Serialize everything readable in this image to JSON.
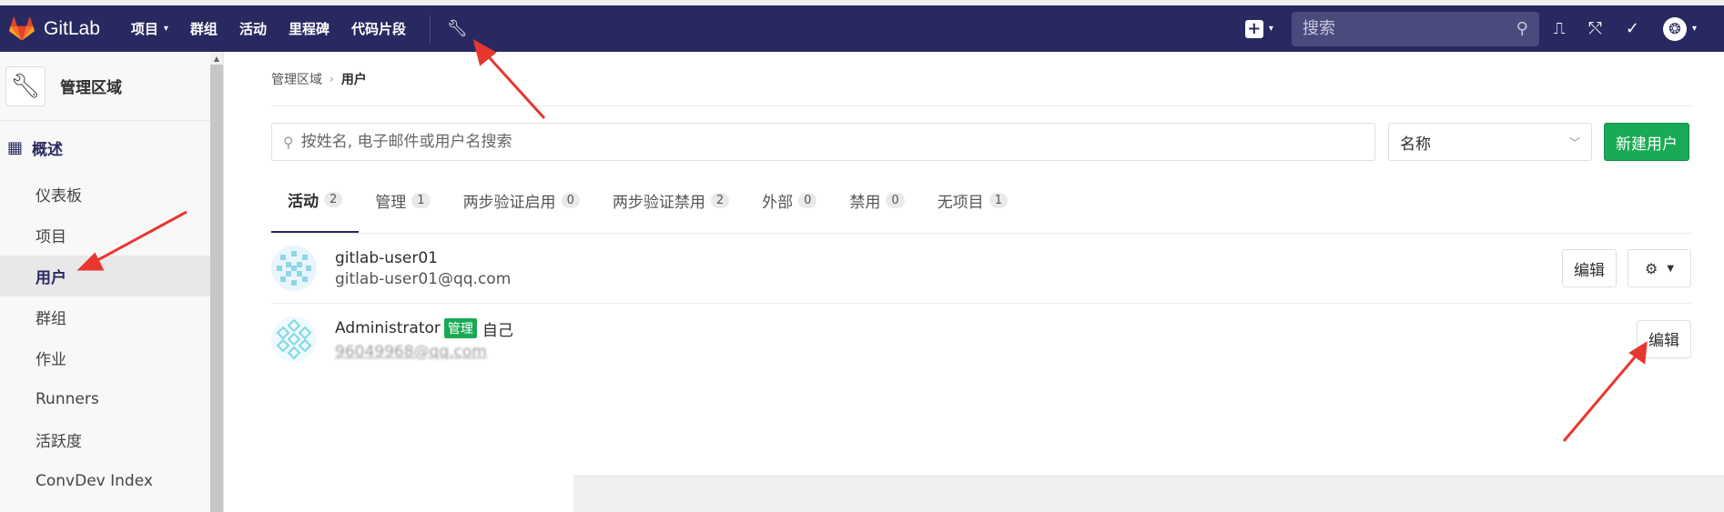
{
  "app": {
    "name": "GitLab"
  },
  "nav": {
    "items": [
      {
        "label": "项目",
        "has_dropdown": true
      },
      {
        "label": "群组",
        "has_dropdown": false
      },
      {
        "label": "活动",
        "has_dropdown": false
      },
      {
        "label": "里程碑",
        "has_dropdown": false
      },
      {
        "label": "代码片段",
        "has_dropdown": false
      }
    ],
    "admin_icon": "wrench-icon",
    "search_placeholder": "搜索",
    "brand_color": "#292961"
  },
  "sidebar": {
    "title": "管理区域",
    "section": "概述",
    "items": [
      {
        "label": "仪表板",
        "active": false
      },
      {
        "label": "项目",
        "active": false
      },
      {
        "label": "用户",
        "active": true
      },
      {
        "label": "群组",
        "active": false
      },
      {
        "label": "作业",
        "active": false
      },
      {
        "label": "Runners",
        "active": false
      },
      {
        "label": "活跃度",
        "active": false
      },
      {
        "label": "ConvDev Index",
        "active": false
      }
    ]
  },
  "breadcrumb": {
    "parent": "管理区域",
    "current": "用户"
  },
  "filter": {
    "placeholder": "按姓名, 电子邮件或用户名搜索",
    "sort_label": "名称",
    "new_user_label": "新建用户",
    "accent_color": "#1aaa55"
  },
  "tabs": [
    {
      "label": "活动",
      "count": "2",
      "active": true
    },
    {
      "label": "管理",
      "count": "1",
      "active": false
    },
    {
      "label": "两步验证启用",
      "count": "0",
      "active": false
    },
    {
      "label": "两步验证禁用",
      "count": "2",
      "active": false
    },
    {
      "label": "外部",
      "count": "0",
      "active": false
    },
    {
      "label": "禁用",
      "count": "0",
      "active": false
    },
    {
      "label": "无项目",
      "count": "1",
      "active": false
    }
  ],
  "users": [
    {
      "name": "gitlab-user01",
      "email": "gitlab-user01@qq.com",
      "admin_badge": "",
      "self_label": "",
      "edit_label": "编辑",
      "has_gear": true
    },
    {
      "name": "Administrator",
      "email": "96049968@qq.com",
      "admin_badge": "管理",
      "self_label": "自己",
      "edit_label": "编辑",
      "has_gear": false
    }
  ]
}
